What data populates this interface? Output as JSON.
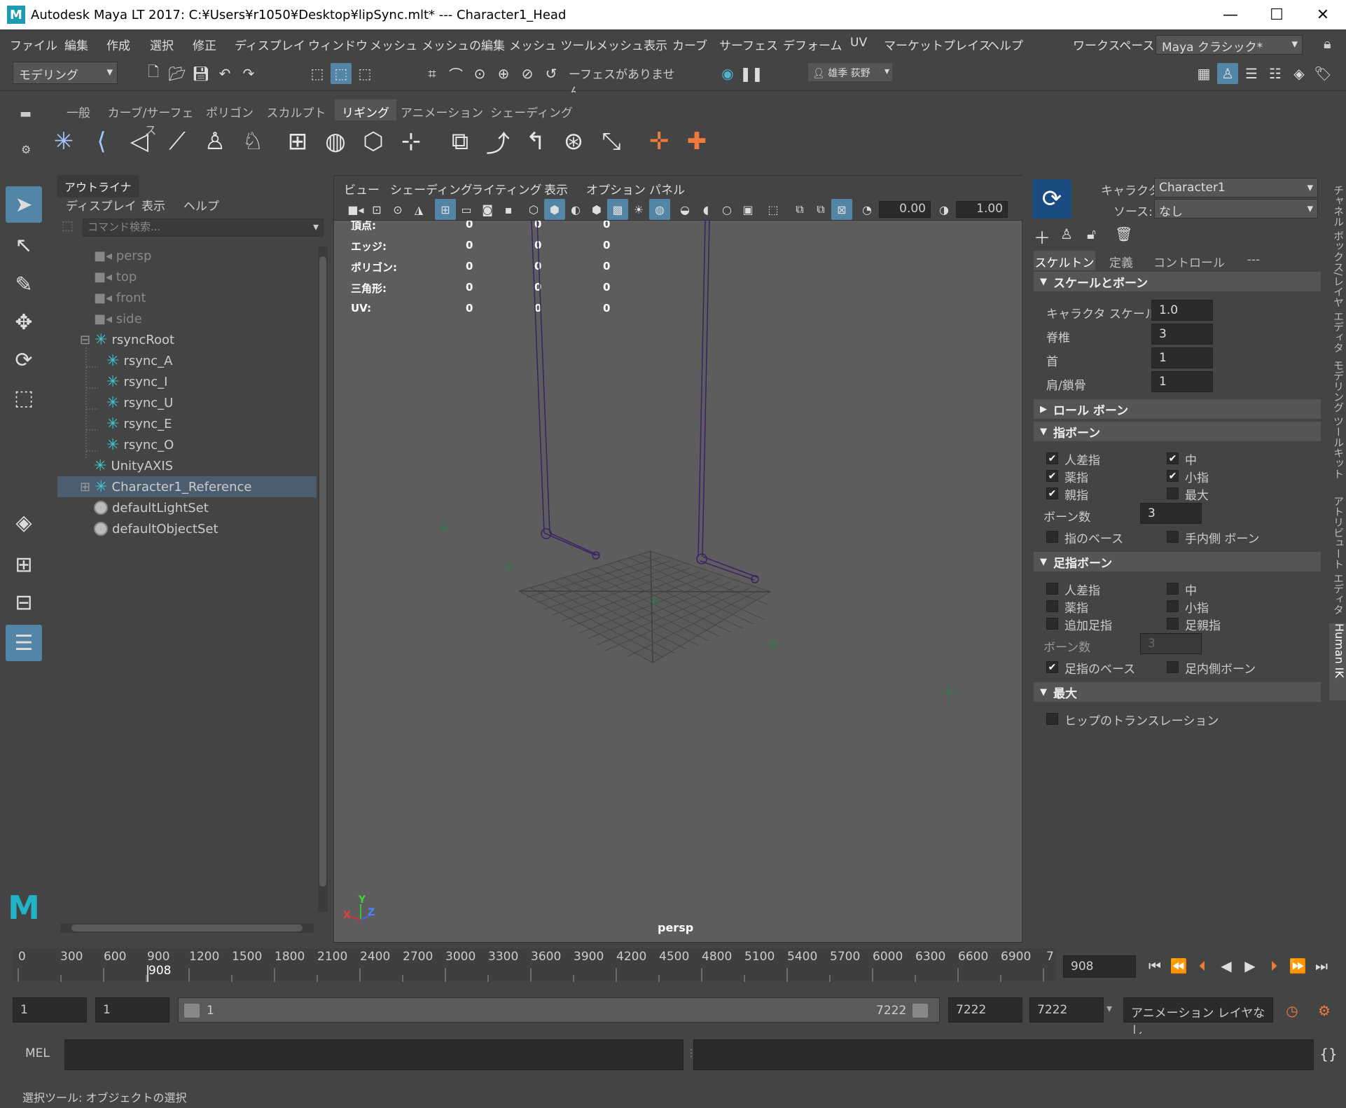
{
  "window": {
    "title": "Autodesk Maya LT 2017: C:¥Users¥r1050¥Desktop¥lipSync.mlt*   ---   Character1_Head",
    "min": "—",
    "max": "☐",
    "close": "✕"
  },
  "menu": [
    "ファイル",
    "編集",
    "作成",
    "選択",
    "修正",
    "ディスプレイ",
    "ウィンドウ",
    "メッシュ",
    "メッシュの編集",
    "メッシュ ツール",
    "メッシュ表示",
    "カーブ",
    "サーフェス",
    "デフォーム",
    "UV",
    "マーケットプレイス",
    "ヘルプ"
  ],
  "workspace": {
    "label": "ワークスペース:",
    "value": "Maya クラシック*"
  },
  "statusline": {
    "mode": "モデリング",
    "live_surface": "ーフェスがありません",
    "user": "雄季 荻野"
  },
  "shelf": {
    "tabs": [
      "一般",
      "カーブ/サーフェス",
      "ポリゴン",
      "スカルプト",
      "リギング",
      "アニメーション",
      "シェーディング"
    ],
    "active": "リギング"
  },
  "outliner": {
    "tab": "アウトライナ",
    "menu": [
      "ディスプレイ",
      "表示",
      "ヘルプ"
    ],
    "search_placeholder": "コマンド検索...",
    "items": [
      {
        "label": "persp",
        "type": "camera"
      },
      {
        "label": "top",
        "type": "camera"
      },
      {
        "label": "front",
        "type": "camera"
      },
      {
        "label": "side",
        "type": "camera"
      },
      {
        "label": "rsyncRoot",
        "type": "joint"
      },
      {
        "label": "rsync_A",
        "type": "joint"
      },
      {
        "label": "rsync_I",
        "type": "joint"
      },
      {
        "label": "rsync_U",
        "type": "joint"
      },
      {
        "label": "rsync_E",
        "type": "joint"
      },
      {
        "label": "rsync_O",
        "type": "joint"
      },
      {
        "label": "UnityAXIS",
        "type": "joint"
      },
      {
        "label": "Character1_Reference",
        "type": "joint"
      },
      {
        "label": "defaultLightSet",
        "type": "set"
      },
      {
        "label": "defaultObjectSet",
        "type": "set"
      }
    ],
    "expand": "⊟",
    "collapse": "⊞"
  },
  "viewport": {
    "menu": [
      "ビュー",
      "シェーディング",
      "ライティング",
      "表示",
      "オプション",
      "パネル"
    ],
    "field1": "0.00",
    "field2": "1.00",
    "hud": [
      {
        "label": "頂点:",
        "v": [
          "0",
          "0",
          "0"
        ]
      },
      {
        "label": "エッジ:",
        "v": [
          "0",
          "0",
          "0"
        ]
      },
      {
        "label": "ポリゴン:",
        "v": [
          "0",
          "0",
          "0"
        ]
      },
      {
        "label": "三角形:",
        "v": [
          "0",
          "0",
          "0"
        ]
      },
      {
        "label": "UV:",
        "v": [
          "0",
          "0",
          "0"
        ]
      }
    ],
    "camera": "persp",
    "axis": {
      "x": "X",
      "y": "Y",
      "z": "Z"
    }
  },
  "hik": {
    "character_label": "キャラクタ:",
    "character_value": "Character1",
    "source_label": "ソース:",
    "source_value": "なし",
    "tabs": [
      "スケルトン",
      "定義",
      "コントロール",
      "---"
    ],
    "sec_scale": "スケールとボーン",
    "scale_rows": [
      {
        "label": "キャラクタ スケール",
        "value": "1.0"
      },
      {
        "label": "脊椎",
        "value": "3"
      },
      {
        "label": "首",
        "value": "1"
      },
      {
        "label": "肩/鎖骨",
        "value": "1"
      }
    ],
    "sec_roll": "ロール ボーン",
    "sec_finger": "指ボーン",
    "finger_checks": [
      {
        "label": "人差指",
        "checked": true
      },
      {
        "label": "中",
        "checked": true
      },
      {
        "label": "薬指",
        "checked": true
      },
      {
        "label": "小指",
        "checked": true
      },
      {
        "label": "親指",
        "checked": true
      },
      {
        "label": "最大",
        "checked": false
      }
    ],
    "finger_bones_label": "ボーン数",
    "finger_bones_value": "3",
    "finger_base": "指のベース",
    "finger_inner": "手内側 ボーン",
    "sec_toe": "足指ボーン",
    "toe_checks": [
      {
        "label": "人差指",
        "checked": false
      },
      {
        "label": "中",
        "checked": false
      },
      {
        "label": "薬指",
        "checked": false
      },
      {
        "label": "小指",
        "checked": false
      },
      {
        "label": "追加足指",
        "checked": false
      },
      {
        "label": "足親指",
        "checked": false
      }
    ],
    "toe_bones_label": "ボーン数",
    "toe_bones_value": "3",
    "toe_base": "足指のベース",
    "toe_inner": "足内側ボーン",
    "sec_max": "最大",
    "hip_translation": "ヒップのトランスレーション"
  },
  "side_tabs": [
    "チャネル ボックス/レイヤ エディタ",
    "モデリング ツールキット",
    "アトリビュート エディタ",
    "Human IK"
  ],
  "timeslider": {
    "ticks": [
      "0",
      "300",
      "600",
      "900",
      "1200",
      "1500",
      "1800",
      "2100",
      "2400",
      "2700",
      "3000",
      "3300",
      "3600",
      "3900",
      "4200",
      "4500",
      "4800",
      "5100",
      "5400",
      "5700",
      "6000",
      "6300",
      "6600",
      "6900",
      "7"
    ],
    "current_marker": "908",
    "current_field": "908"
  },
  "range": {
    "start": "1",
    "start2": "1",
    "inner_start": "1",
    "inner_end": "7222",
    "end": "7222",
    "end2": "7222",
    "anim_layer": "アニメーション レイヤなし"
  },
  "cmdline": {
    "label": "MEL"
  },
  "helpline": {
    "text": "選択ツール: オブジェクトの選択"
  }
}
